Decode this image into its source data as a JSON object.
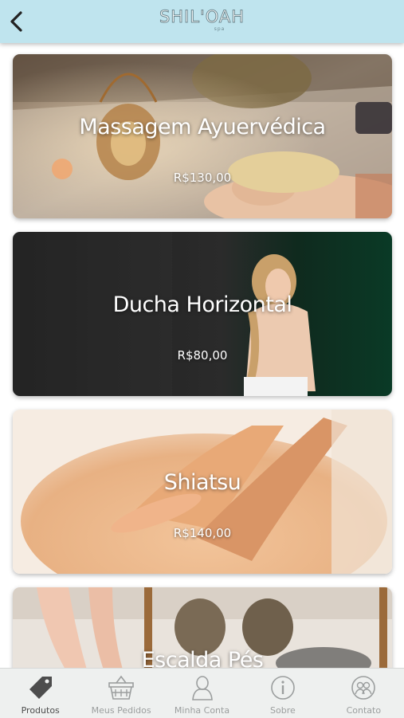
{
  "header": {
    "logo_text": "SHIL'OAH",
    "logo_sub": "spa",
    "back_icon": "chevron-left-icon"
  },
  "products": [
    {
      "title": "Massagem Ayuervédica",
      "price": "R$130,00"
    },
    {
      "title": "Ducha Horizontal",
      "price": "R$80,00"
    },
    {
      "title": "Shiatsu",
      "price": "R$140,00"
    },
    {
      "title": "Escalda Pés",
      "price": ""
    }
  ],
  "tabbar": {
    "items": [
      {
        "label": "Produtos",
        "icon": "tag-icon",
        "active": true
      },
      {
        "label": "Meus Pedidos",
        "icon": "basket-icon",
        "active": false
      },
      {
        "label": "Minha Conta",
        "icon": "user-icon",
        "active": false
      },
      {
        "label": "Sobre",
        "icon": "info-icon",
        "active": false
      },
      {
        "label": "Contato",
        "icon": "contacts-icon",
        "active": false
      }
    ]
  },
  "colors": {
    "header_bg": "#bfe4ee",
    "tabbar_bg": "#eef0ef",
    "active_tab": "#4d4d4d",
    "inactive_tab": "#9b9e9e"
  }
}
